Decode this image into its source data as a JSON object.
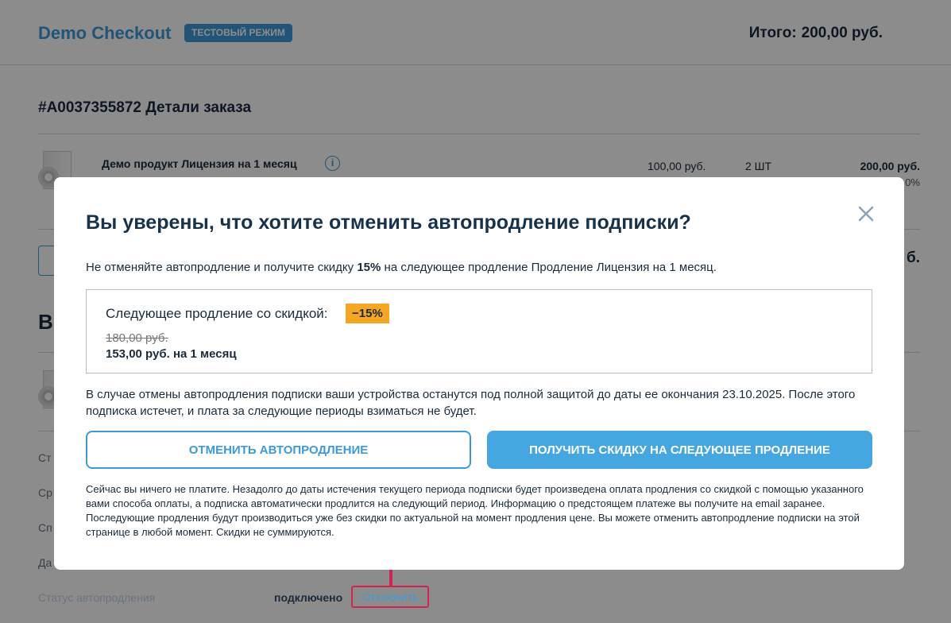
{
  "header": {
    "brand": "Demo Checkout",
    "mode_badge": "ТЕСТОВЫЙ РЕЖИМ",
    "total_label": "Итого:",
    "total_amount": "200,00 руб."
  },
  "order": {
    "title": "#A0037355872 Детали заказа",
    "product": {
      "name": "Демо продукт Лицензия на 1 месяц",
      "unit_price": "100,00 руб.",
      "quantity": "2 ШТ",
      "line_total": "200,00 руб.",
      "discount_fragment": "0%"
    },
    "summary_total_fragment": "б.",
    "section_fragment": "В",
    "detail_label_fragments": [
      "Ст",
      "Ср",
      "Сп",
      "Да"
    ]
  },
  "autorenew": {
    "label": "Статус автопродления",
    "value": "подключено",
    "disable_link": "Отключить"
  },
  "modal": {
    "title": "Вы уверены, что хотите отменить автопродление подписки?",
    "intro_before": "Не отменяйте автопродление и получите скидку ",
    "intro_discount": "15%",
    "intro_after": " на следующее продление Продление Лицензия на 1 месяц.",
    "offer": {
      "label": "Следующее продление со скидкой:",
      "badge": "−15%",
      "old_price": "180,00 руб.",
      "new_price": "153,00 руб. на 1 месяц"
    },
    "cancel_note": "В случае отмены автопродления подписки ваши устройства останутся под полной защитой до даты ее окончания 23.10.2025. После этого подписка истечет, и плата за следующие периоды взиматься не будет.",
    "cancel_button": "Отменить автопродление",
    "discount_button": "Получить скидку на следующее продление",
    "fine_print": "Сейчас вы ничего не платите. Незадолго до даты истечения текущего периода подписки будет произведена оплата продления со скидкой с помощью указанного вами способа оплаты, а подписка автоматически продлится на следующий период. Информацию о предстоящем платеже вы получите на email заранее. Последующие продления будут производиться уже без скидки по актуальной на момент продления цене. Вы можете отменить автопродление подписки на этой странице в любой момент. Скидки не суммируются."
  },
  "colors": {
    "accent": "#3d9ad8",
    "primary_button": "#45a6e2",
    "discount_badge": "#f5a623",
    "annotation": "#d0254f"
  },
  "icons": {
    "close": "close-icon",
    "info": "info-icon",
    "arrow": "arrow-up-icon"
  }
}
